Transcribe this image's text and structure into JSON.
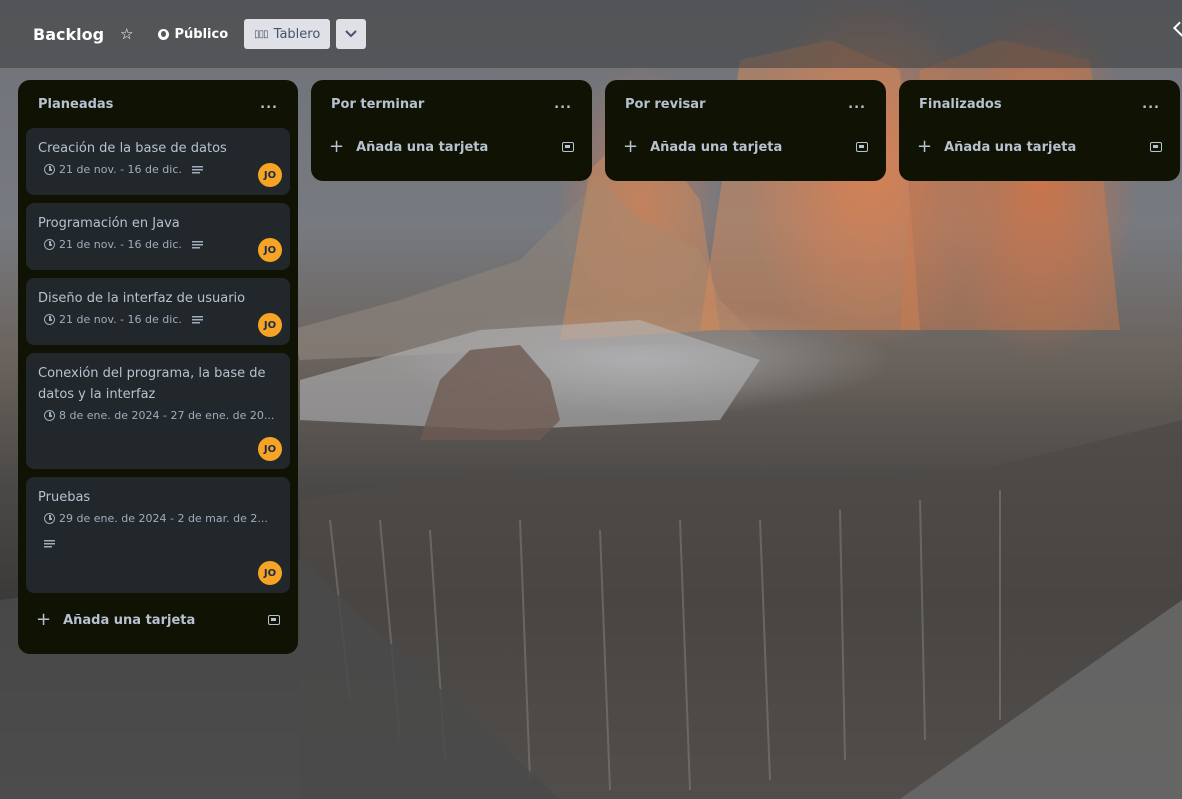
{
  "header": {
    "title": "Backlog",
    "visibility": "Público",
    "view_label": "Tablero"
  },
  "icons": {
    "star": "star-icon",
    "globe": "globe-icon",
    "board": "board-icon",
    "chevron": "chevron-down-icon",
    "clock": "clock-icon",
    "description": "description-icon",
    "plus": "plus-icon",
    "template": "card-template-icon"
  },
  "colors": {
    "list_bg": "#101204",
    "card_bg": "#22272b",
    "avatar_bg": "#f7a424"
  },
  "lists": [
    {
      "title": "Planeadas",
      "menu": "...",
      "add_label": "Añada una tarjeta",
      "cards": [
        {
          "title": "Creación de la base de datos",
          "date": "21 de nov. - 16 de dic.",
          "avatar": "JO"
        },
        {
          "title": "Programación en Java",
          "date": "21 de nov. - 16 de dic.",
          "avatar": "JO"
        },
        {
          "title": "Diseño de la interfaz de usuario",
          "date": "21 de nov. - 16 de dic.",
          "avatar": "JO"
        },
        {
          "title": "Conexión del programa, la base de datos y la interfaz",
          "date": "8 de ene. de 2024 - 27 de ene. de 20...",
          "avatar": "JO"
        },
        {
          "title": "Pruebas",
          "date": "29 de ene. de 2024 - 2 de mar. de 2...",
          "avatar": "JO"
        }
      ]
    },
    {
      "title": "Por terminar",
      "menu": "...",
      "add_label": "Añada una tarjeta"
    },
    {
      "title": "Por revisar",
      "menu": "...",
      "add_label": "Añada una tarjeta"
    },
    {
      "title": "Finalizados",
      "menu": "...",
      "add_label": "Añada una tarjeta"
    }
  ]
}
